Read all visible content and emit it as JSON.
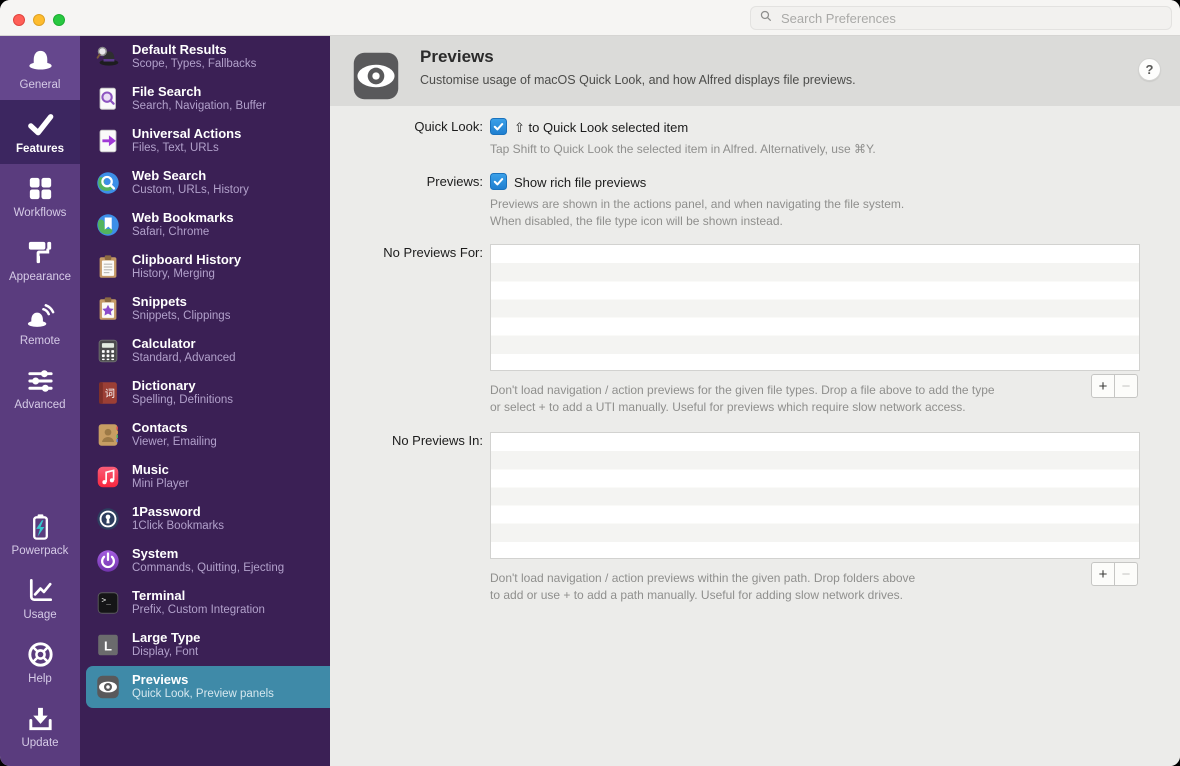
{
  "window": {
    "search_placeholder": "Search Preferences"
  },
  "rail": {
    "top_items": [
      {
        "label": "General",
        "icon": "hat-icon",
        "selected": false,
        "lite": true
      },
      {
        "label": "Features",
        "icon": "check-icon",
        "selected": true,
        "lite": false
      },
      {
        "label": "Workflows",
        "icon": "grid-icon",
        "selected": false,
        "lite": false
      },
      {
        "label": "Appearance",
        "icon": "paint-roller-icon",
        "selected": false,
        "lite": false
      },
      {
        "label": "Remote",
        "icon": "remote-hat-icon",
        "selected": false,
        "lite": false
      },
      {
        "label": "Advanced",
        "icon": "sliders-icon",
        "selected": false,
        "lite": false
      }
    ],
    "bottom_items": [
      {
        "label": "Powerpack",
        "icon": "battery-bolt-icon",
        "selected": false,
        "lite": false
      },
      {
        "label": "Usage",
        "icon": "chart-icon",
        "selected": false,
        "lite": false
      },
      {
        "label": "Help",
        "icon": "lifebuoy-icon",
        "selected": false,
        "lite": false
      },
      {
        "label": "Update",
        "icon": "download-icon",
        "selected": false,
        "lite": false
      }
    ]
  },
  "sidebar": {
    "items": [
      {
        "title": "Default Results",
        "subtitle": "Scope, Types, Fallbacks",
        "icon": "alfred-hat-icon",
        "selected": false
      },
      {
        "title": "File Search",
        "subtitle": "Search, Navigation, Buffer",
        "icon": "file-search-icon",
        "selected": false
      },
      {
        "title": "Universal Actions",
        "subtitle": "Files, Text, URLs",
        "icon": "universal-actions-icon",
        "selected": false
      },
      {
        "title": "Web Search",
        "subtitle": "Custom, URLs, History",
        "icon": "web-search-icon",
        "selected": false
      },
      {
        "title": "Web Bookmarks",
        "subtitle": "Safari, Chrome",
        "icon": "web-bookmarks-icon",
        "selected": false
      },
      {
        "title": "Clipboard History",
        "subtitle": "History, Merging",
        "icon": "clipboard-icon",
        "selected": false
      },
      {
        "title": "Snippets",
        "subtitle": "Snippets, Clippings",
        "icon": "snippets-icon",
        "selected": false
      },
      {
        "title": "Calculator",
        "subtitle": "Standard, Advanced",
        "icon": "calculator-icon",
        "selected": false
      },
      {
        "title": "Dictionary",
        "subtitle": "Spelling, Definitions",
        "icon": "dictionary-icon",
        "selected": false
      },
      {
        "title": "Contacts",
        "subtitle": "Viewer, Emailing",
        "icon": "contacts-icon",
        "selected": false
      },
      {
        "title": "Music",
        "subtitle": "Mini Player",
        "icon": "music-icon",
        "selected": false
      },
      {
        "title": "1Password",
        "subtitle": "1Click Bookmarks",
        "icon": "onepassword-icon",
        "selected": false
      },
      {
        "title": "System",
        "subtitle": "Commands, Quitting, Ejecting",
        "icon": "system-icon",
        "selected": false
      },
      {
        "title": "Terminal",
        "subtitle": "Prefix, Custom Integration",
        "icon": "terminal-icon",
        "selected": false
      },
      {
        "title": "Large Type",
        "subtitle": "Display, Font",
        "icon": "large-type-icon",
        "selected": false
      },
      {
        "title": "Previews",
        "subtitle": "Quick Look, Preview panels",
        "icon": "previews-eye-icon",
        "selected": true
      }
    ]
  },
  "main": {
    "header": {
      "title": "Previews",
      "description": "Customise usage of macOS Quick Look, and how Alfred displays file previews.",
      "icon": "previews-eye-icon",
      "help_label": "?"
    },
    "quick_look": {
      "label": "Quick Look:",
      "checked": true,
      "checkbox_label": "⇧ to Quick Look selected item",
      "helper": "Tap Shift to Quick Look the selected item in Alfred. Alternatively, use ⌘Y."
    },
    "previews": {
      "label": "Previews:",
      "checked": true,
      "checkbox_label": "Show rich file previews",
      "helper": "Previews are shown in the actions panel, and when navigating the file system.\nWhen disabled, the file type icon will be shown instead."
    },
    "no_previews_for": {
      "label": "No Previews For:",
      "visible_rows": 7,
      "items": [],
      "helper": "Don't load navigation / action previews for the given file types. Drop a file above to add the type\nor select + to add a UTI manually. Useful for previews which require slow network access.",
      "add_label": "+",
      "remove_label": "−"
    },
    "no_previews_in": {
      "label": "No Previews In:",
      "visible_rows": 7,
      "items": [],
      "helper": "Don't load navigation / action previews within the given path. Drop folders above\nto add or use + to add a path manually. Useful for adding slow network drives.",
      "add_label": "+",
      "remove_label": "−"
    }
  },
  "colors": {
    "rail_bg": "#5a3c7e",
    "rail_selected_bg": "#3c2660",
    "sidebar_bg": "#3b2055",
    "sidebar_selected_bg": "#3f8aa8",
    "header_band_bg": "#dbdbd9",
    "content_bg": "#ececea",
    "checkbox_blue": "#2e8fd2",
    "traffic_red": "#ff5f57",
    "traffic_yellow": "#febc2e",
    "traffic_green": "#28c840"
  }
}
